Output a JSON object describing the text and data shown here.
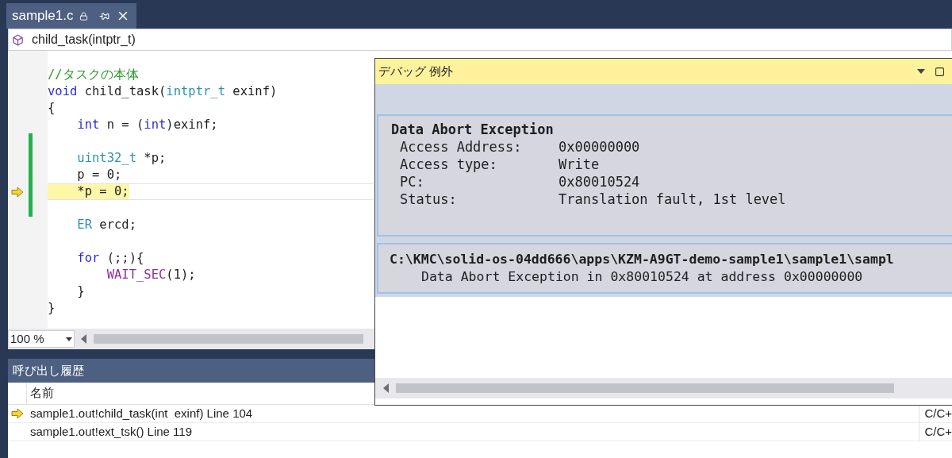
{
  "tab": {
    "title": "sample1.c"
  },
  "nav": {
    "member": "child_task(intptr_t)"
  },
  "code_lines": [
    {
      "tokens": [
        {
          "kind": "comment",
          "text": "//タスクの本体"
        }
      ],
      "changed": false,
      "current": false
    },
    {
      "tokens": [
        {
          "kind": "keyword",
          "text": "void"
        },
        {
          "kind": "plain",
          "text": " child_task("
        },
        {
          "kind": "type",
          "text": "intptr_t"
        },
        {
          "kind": "plain",
          "text": " exinf)"
        }
      ],
      "changed": false,
      "current": false
    },
    {
      "tokens": [
        {
          "kind": "plain",
          "text": "{"
        }
      ],
      "changed": false,
      "current": false
    },
    {
      "tokens": [
        {
          "kind": "keyword",
          "text": "    int"
        },
        {
          "kind": "plain",
          "text": " n = ("
        },
        {
          "kind": "keyword",
          "text": "int"
        },
        {
          "kind": "plain",
          "text": ")exinf;"
        }
      ],
      "changed": false,
      "current": false
    },
    {
      "changed": true,
      "current": false
    },
    {
      "tokens": [
        {
          "kind": "type",
          "text": "    uint32_t"
        },
        {
          "kind": "plain",
          "text": " *p;"
        }
      ],
      "changed": true,
      "current": false
    },
    {
      "tokens": [
        {
          "kind": "plain",
          "text": "    p = 0;"
        }
      ],
      "changed": true,
      "current": false
    },
    {
      "tokens": [
        {
          "kind": "plain",
          "text": "    *p = 0;"
        }
      ],
      "changed": true,
      "current": true
    },
    {
      "changed": true,
      "current": false
    },
    {
      "tokens": [
        {
          "kind": "type",
          "text": "    ER"
        },
        {
          "kind": "plain",
          "text": " ercd;"
        }
      ],
      "changed": false,
      "current": false
    },
    {
      "changed": false,
      "current": false
    },
    {
      "tokens": [
        {
          "kind": "keyword",
          "text": "    for"
        },
        {
          "kind": "plain",
          "text": " (;;){"
        }
      ],
      "changed": false,
      "current": false
    },
    {
      "tokens": [
        {
          "kind": "macro",
          "text": "        WAIT_SEC"
        },
        {
          "kind": "plain",
          "text": "(1);"
        }
      ],
      "changed": false,
      "current": false
    },
    {
      "tokens": [
        {
          "kind": "plain",
          "text": "    }"
        }
      ],
      "changed": false,
      "current": false
    },
    {
      "tokens": [
        {
          "kind": "plain",
          "text": "}"
        }
      ],
      "changed": false,
      "current": false
    }
  ],
  "zoom": {
    "value": "100 %"
  },
  "exception": {
    "title": "デバッグ 例外",
    "heading": "Data Abort Exception",
    "fields": [
      {
        "label": "Access Address:",
        "value": "0x00000000"
      },
      {
        "label": "Access type:",
        "value": "Write"
      },
      {
        "label": "PC:",
        "value": "0x80010524"
      },
      {
        "label": "Status:",
        "value": "Translation fault, 1st level"
      }
    ],
    "location": "C:\\KMC\\solid-os-04dd666\\apps\\KZM-A9GT-demo-sample1\\sample1\\sampl",
    "message": "Data Abort Exception in 0x80010524 at address 0x00000000"
  },
  "call_stack": {
    "title": "呼び出し履歴",
    "columns": [
      "名前"
    ],
    "rows": [
      {
        "name": "sample1.out!child_task(int  exinf) Line 104",
        "column_2": "C/C+",
        "current": true
      },
      {
        "name": "sample1.out!ext_tsk() Line 119",
        "column_2": "C/C+",
        "current": false
      }
    ]
  }
}
